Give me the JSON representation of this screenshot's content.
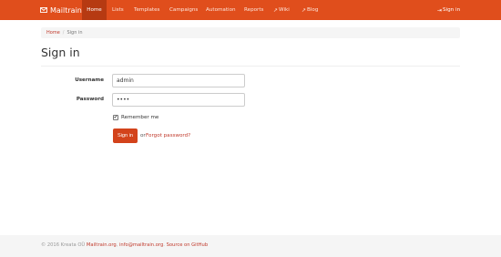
{
  "navbar": {
    "brand": "Mailtrain",
    "items": [
      {
        "label": "Home",
        "active": true
      },
      {
        "label": "Lists",
        "active": false
      },
      {
        "label": "Templates",
        "active": false
      },
      {
        "label": "Campaigns",
        "active": false
      },
      {
        "label": "Automation",
        "active": false
      },
      {
        "label": "Reports",
        "active": false
      },
      {
        "label": "Wiki",
        "icon": "external-link-icon"
      },
      {
        "label": "Blog",
        "icon": "external-link-icon"
      }
    ],
    "signin": {
      "label": "Sign in",
      "icon": "sign-in-icon"
    },
    "accent": "#e04e1c"
  },
  "breadcrumb": {
    "home": "Home",
    "separator": "/",
    "current": "Sign in"
  },
  "page": {
    "title": "Sign in"
  },
  "form": {
    "username_label": "Username",
    "username_value": "admin",
    "password_label": "Password",
    "password_value": "••••",
    "remember_label": "Remember me",
    "remember_checked": "✔",
    "submit_label": "Sign in",
    "or_text": "or",
    "forgot_label": "Forgot password?"
  },
  "footer": {
    "copyright": "© 2016 Kreata OÜ",
    "link1": "Mailtrain.org",
    "comma": ",",
    "link2": "info@mailtrain.org",
    "dot": ".",
    "link3": "Source on GitHub"
  }
}
